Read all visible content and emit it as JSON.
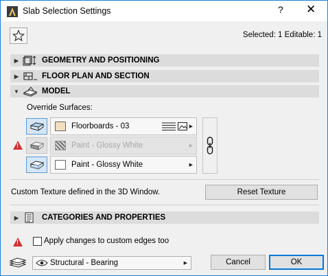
{
  "window": {
    "title": "Slab Selection Settings",
    "help_label": "?",
    "close_label": "✕"
  },
  "header": {
    "selected_info": "Selected: 1 Editable: 1"
  },
  "panels": [
    {
      "label": "GEOMETRY AND POSITIONING",
      "expanded": false
    },
    {
      "label": "FLOOR PLAN AND SECTION",
      "expanded": false
    },
    {
      "label": "MODEL",
      "expanded": true
    },
    {
      "label": "CATEGORIES AND PROPERTIES",
      "expanded": false
    }
  ],
  "model": {
    "override_label": "Override Surfaces:",
    "surfaces": [
      {
        "name": "Floorboards - 03",
        "color": "#f3dfbf",
        "enabled": true
      },
      {
        "name": "Paint - Glossy White",
        "color": "#ffffff",
        "enabled": false
      },
      {
        "name": "Paint - Glossy White",
        "color": "#ffffff",
        "enabled": true
      }
    ],
    "texture_text": "Custom Texture defined in the 3D Window.",
    "reset_texture_label": "Reset Texture"
  },
  "footer": {
    "apply_edges_label": "Apply changes to custom edges too",
    "apply_edges_checked": false,
    "layer_value": "Structural - Bearing",
    "cancel_label": "Cancel",
    "ok_label": "OK"
  },
  "colors": {
    "window_border": "#1c7fd6",
    "panel_header": "#dcdcdc",
    "active_toggle": "#d4e6f7",
    "warning": "#d32f2f",
    "ok_focus": "#0078d7"
  }
}
